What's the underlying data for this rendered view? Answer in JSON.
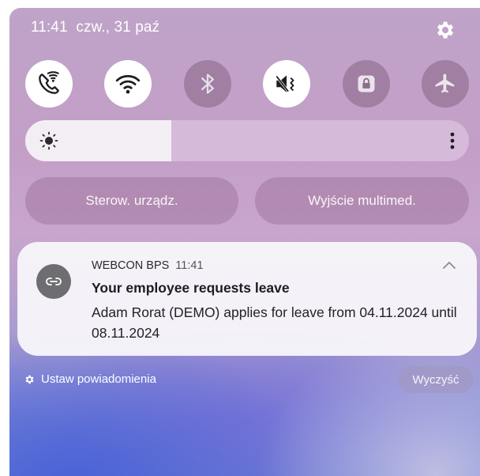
{
  "status_bar": {
    "time": "11:41",
    "date": "czw., 31 paź",
    "settings_icon": "gear-icon"
  },
  "quick_tiles": [
    {
      "name": "wifi-calling-icon",
      "state": "on"
    },
    {
      "name": "wifi-icon",
      "state": "on"
    },
    {
      "name": "bluetooth-icon",
      "state": "off"
    },
    {
      "name": "sound-muted-icon",
      "state": "on"
    },
    {
      "name": "lock-icon",
      "state": "off"
    },
    {
      "name": "airplane-icon",
      "state": "off"
    }
  ],
  "brightness": {
    "level": 0.33,
    "icon": "sun-icon",
    "menu_icon": "more-vertical-icon"
  },
  "buttons": {
    "device_control": "Sterow. urządz.",
    "media_output": "Wyjście multimed."
  },
  "notification": {
    "app_name": "WEBCON BPS",
    "time": "11:41",
    "title": "Your employee requests leave",
    "body": "Adam Rorat (DEMO) applies for leave from 04.11.2024 until 08.11.2024",
    "app_icon": "link-icon",
    "expand_icon": "chevron-up-icon"
  },
  "footer": {
    "settings_label": "Ustaw powiadomienia",
    "clear_label": "Wyczyść"
  },
  "colors": {
    "tile_on": "#ffffff",
    "tile_off": "#78567673",
    "icon_dark": "#1e1e22"
  }
}
